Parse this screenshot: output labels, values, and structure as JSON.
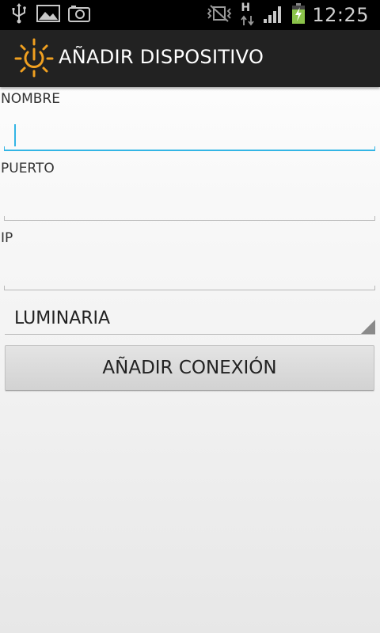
{
  "status_bar": {
    "time": "12:25",
    "network_type": "H",
    "icons": [
      "usb-icon",
      "gallery-icon",
      "camera-icon",
      "no-sim-vibrate-icon",
      "data-arrows-icon",
      "signal-icon",
      "battery-charging-icon"
    ],
    "battery_color": "#8bc34a"
  },
  "action_bar": {
    "title": "AÑADIR DISPOSITIVO",
    "icon": "power-sun-icon",
    "icon_color": "#f0a020"
  },
  "form": {
    "nombre_label": "NOMBRE",
    "nombre_value": "",
    "puerto_label": "PUERTO",
    "puerto_value": "",
    "ip_label": "IP",
    "ip_value": "",
    "type_selected": "LUMINARIA",
    "submit_label": "AÑADIR CONEXIÓN",
    "accent_color": "#33b5e5"
  }
}
